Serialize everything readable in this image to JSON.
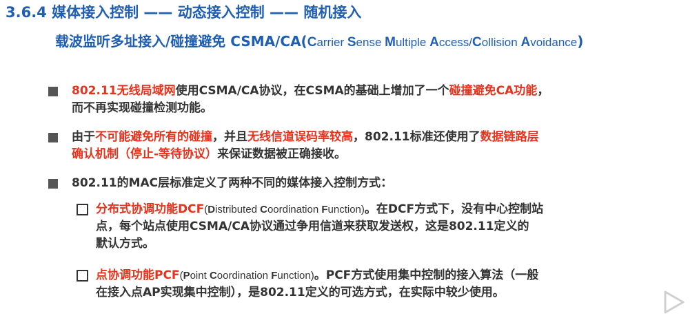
{
  "title": {
    "line1": "3.6.4 媒体接入控制 —— 动态接入控制 —— 随机接入",
    "line2_cn": "载波监听多址接入/碰撞避免 CSMA/CA(",
    "line2_en": {
      "c1": "C",
      "t1": "arrier ",
      "c2": "S",
      "t2": "ense ",
      "c3": "M",
      "t3": "ultiple ",
      "c4": "A",
      "t4": "ccess/",
      "c5": "C",
      "t5": "ollision ",
      "c6": "A",
      "t6": "voidance",
      "end": ")"
    }
  },
  "bullets": [
    {
      "hl1": "802.11无线局域网",
      "t1": "使用CSMA/CA协议，在CSMA的基础上增加了一个",
      "hl2": "碰撞避免CA功能",
      "t2": "，",
      "line2": "而不再实现碰撞检测功能。"
    },
    {
      "t0": "由于",
      "hl1": "不可能避免所有的碰撞",
      "t1": "，并且",
      "hl2": "无线信道误码率较高",
      "t2": "，802.11标准还使用了",
      "hl3": "数据链路层",
      "hl4": "确认机制（停止-等待协议）",
      "t3": "来保证数据被正确接收。"
    },
    {
      "text": "802.11的MAC层标准定义了两种不同的媒体接入控制方式："
    }
  ],
  "sub_items": [
    {
      "hl": "分布式协调功能DCF",
      "en_open": "(",
      "en": {
        "c1": "D",
        "t1": "istributed ",
        "c2": "C",
        "t2": "oordination ",
        "c3": "F",
        "t3": "unction"
      },
      "en_close": ")",
      "t1": "。在DCF方式下，没有中心控制站",
      "line2": "点，每个站点使用CSMA/CA协议通过争用信道来获取发送权，这是802.11定义的",
      "line3": "默认方式。"
    },
    {
      "hl": "点协调功能PCF",
      "en_open": "(",
      "en": {
        "c1": "P",
        "t1": "oint ",
        "c2": "C",
        "t2": "oordination ",
        "c3": "F",
        "t3": "unction"
      },
      "en_close": ")",
      "t1": "。PCF方式使用集中控制的接入算法（一般",
      "line2": "在接入点AP实现集中控制），是802.11定义的可选方式，在实际中较少使用。"
    }
  ],
  "colors": {
    "title": "#1f5fb3",
    "highlight": "#e8321c",
    "text": "#333333"
  },
  "icons": {
    "play": "play-triangle-icon"
  }
}
